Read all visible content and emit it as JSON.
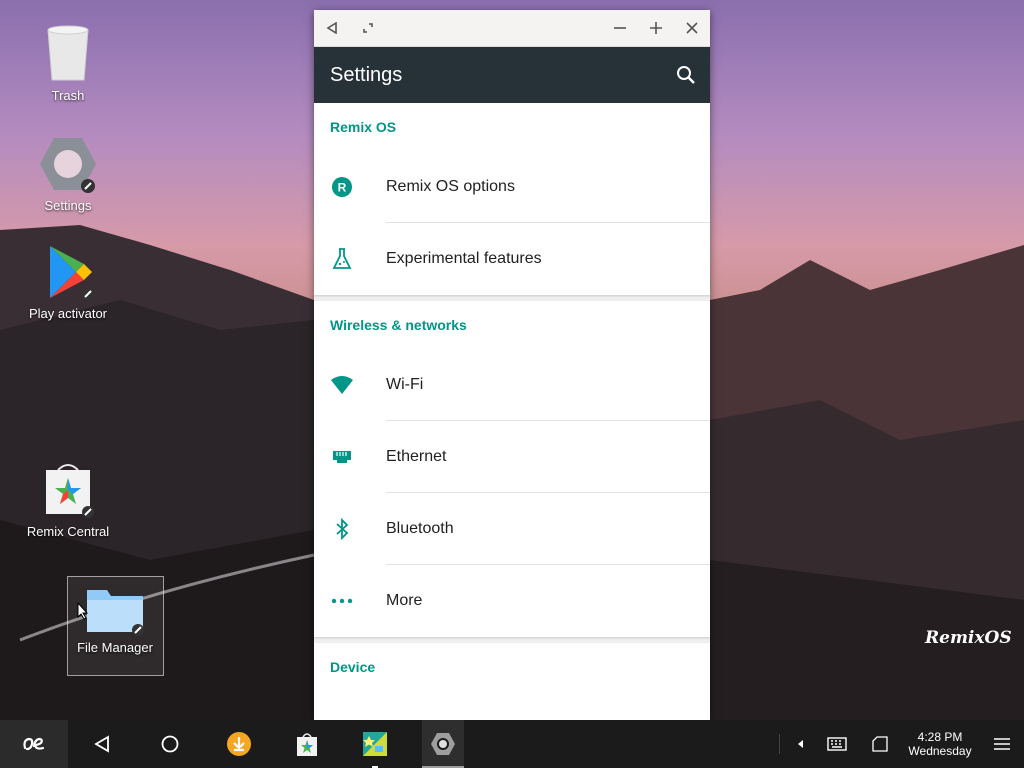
{
  "desktop": {
    "icons": [
      {
        "label": "Trash",
        "icon": "trash-icon"
      },
      {
        "label": "Settings",
        "icon": "settings-gear-icon"
      },
      {
        "label": "Play activator",
        "icon": "play-store-icon"
      },
      {
        "label": "Remix Central",
        "icon": "remix-central-icon"
      },
      {
        "label": "File Manager",
        "icon": "folder-icon"
      }
    ],
    "watermark": "RemixOS"
  },
  "window": {
    "title": "Settings",
    "sections": [
      {
        "title": "Remix OS",
        "items": [
          {
            "label": "Remix OS options",
            "icon": "remix-r-icon"
          },
          {
            "label": "Experimental features",
            "icon": "flask-icon"
          }
        ]
      },
      {
        "title": "Wireless & networks",
        "items": [
          {
            "label": "Wi-Fi",
            "icon": "wifi-icon"
          },
          {
            "label": "Ethernet",
            "icon": "ethernet-icon"
          },
          {
            "label": "Bluetooth",
            "icon": "bluetooth-icon"
          },
          {
            "label": "More",
            "icon": "more-dots-icon"
          }
        ]
      },
      {
        "title": "Device",
        "items": []
      }
    ]
  },
  "taskbar": {
    "time": "4:28 PM",
    "day": "Wednesday"
  },
  "colors": {
    "accent": "#009688",
    "appbar": "#263238",
    "taskbar": "#1b1b1b"
  }
}
